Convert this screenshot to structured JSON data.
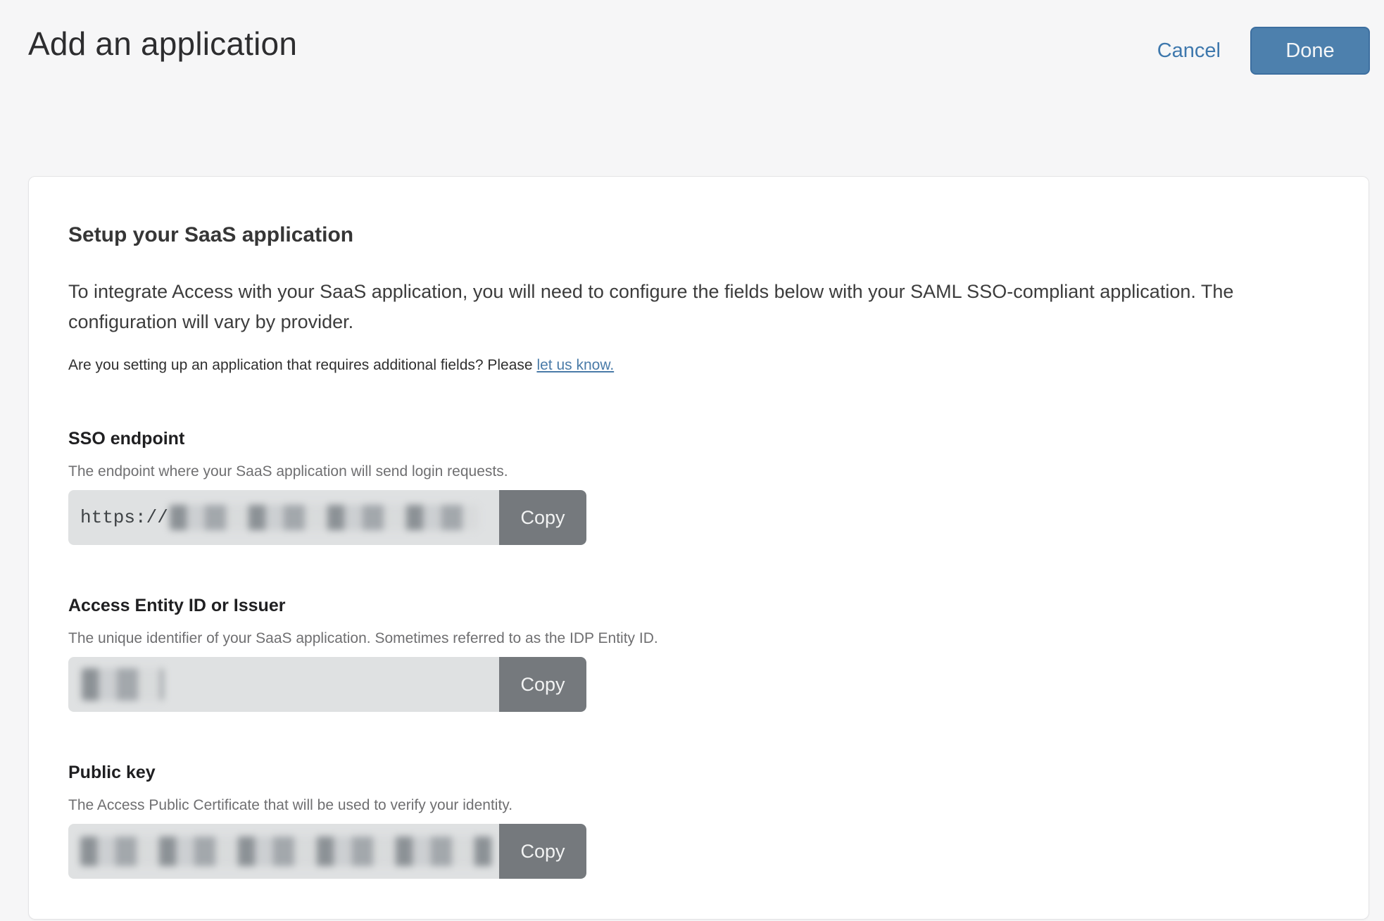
{
  "page": {
    "title": "Add an application",
    "cancel_label": "Cancel",
    "done_label": "Done"
  },
  "setup": {
    "heading": "Setup your SaaS application",
    "intro": "To integrate Access with your SaaS application, you will need to configure the fields below with your SAML SSO-compliant application. The configuration will vary by provider.",
    "note_prefix": "Are you setting up an application that requires additional fields? Please ",
    "note_link": "let us know.",
    "fields": [
      {
        "label": "SSO endpoint",
        "description": "The endpoint where your SaaS application will send login requests.",
        "value_prefix": "https://",
        "value_state": "redacted",
        "copy_label": "Copy"
      },
      {
        "label": "Access Entity ID or Issuer",
        "description": "The unique identifier of your SaaS application. Sometimes referred to as the IDP Entity ID.",
        "value_prefix": "",
        "value_state": "redacted",
        "copy_label": "Copy"
      },
      {
        "label": "Public key",
        "description": "The Access Public Certificate that will be used to verify your identity.",
        "value_prefix": "",
        "value_state": "redacted",
        "copy_label": "Copy"
      }
    ]
  },
  "colors": {
    "accent_blue": "#4d80ad",
    "accent_blue_border": "#3d6fa0",
    "link_blue": "#3e78ad",
    "copy_gray": "#75797d",
    "input_bg": "#dfe1e2",
    "page_bg": "#f6f6f7",
    "card_bg": "#ffffff"
  }
}
